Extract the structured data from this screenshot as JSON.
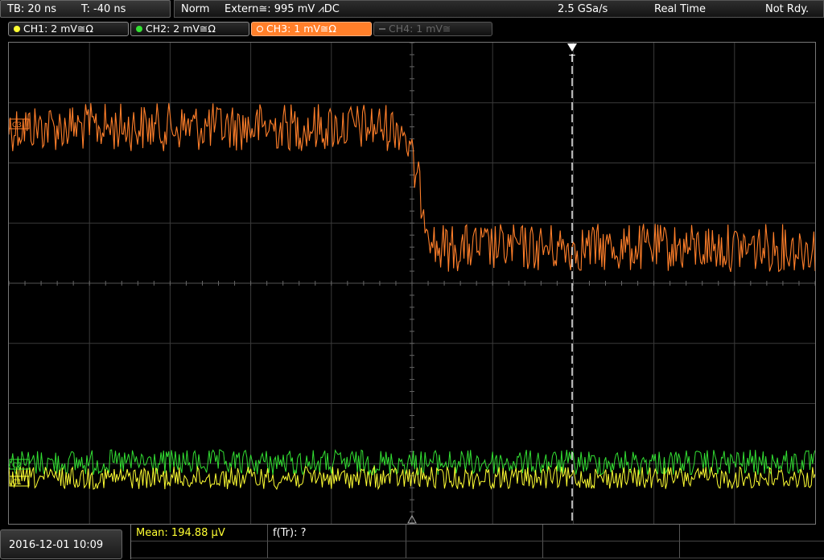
{
  "topbar": {
    "timebase": "TB: 20 ns",
    "trigger_offset": "T: -40 ns",
    "acq_mode": "Norm",
    "trigger_info": "Extern≅: 995 mV ⩘DC",
    "sample_rate": "2.5 GSa/s",
    "acq_type": "Real Time",
    "status": "Not Rdy."
  },
  "channels": [
    {
      "label": "CH1: 2 mV≅Ω",
      "color": "#ffff33",
      "state": "on"
    },
    {
      "label": "CH2: 2 mV≅Ω",
      "color": "#33e033",
      "state": "on"
    },
    {
      "label": "CH3: 1 mV≅Ω",
      "color": "#ff7f2a",
      "state": "active"
    },
    {
      "label": "CH4: 1 mV≅",
      "color": "#666666",
      "state": "off"
    }
  ],
  "markers": {
    "ch3": "C3",
    "ch2": "C2",
    "ch1": "C1",
    "trigger": "T"
  },
  "bottom": {
    "datetime": "2016-12-01 10:09",
    "mean": "Mean: 194.88 µV",
    "ftr": "f(Tr): ?"
  }
}
